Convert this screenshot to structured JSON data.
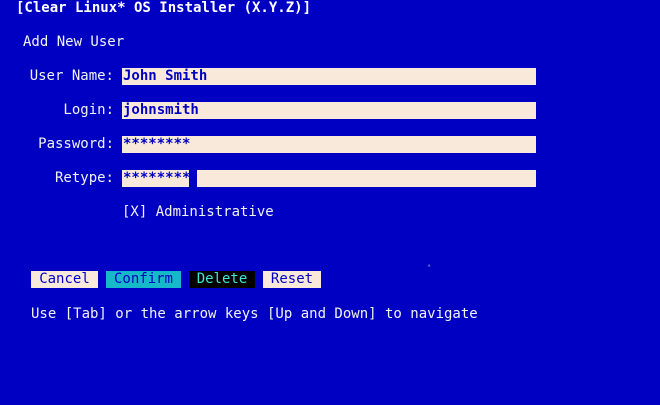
{
  "app": {
    "title": "[Clear Linux* OS Installer (X.Y.Z)]"
  },
  "page": {
    "title": "Add New User"
  },
  "form": {
    "user_name": {
      "label": "User Name:",
      "value": "John Smith"
    },
    "login": {
      "label": "Login:",
      "value": "johnsmith"
    },
    "password": {
      "label": "Password:",
      "value": "********"
    },
    "retype": {
      "label": "Retype:",
      "value": "********"
    },
    "administrative": {
      "label": "[X] Administrative",
      "checked": true
    }
  },
  "buttons": {
    "cancel": "Cancel",
    "confirm": "Confirm",
    "delete": "Delete",
    "reset": "Reset"
  },
  "help_text": "Use [Tab] or the arrow keys [Up and Down] to navigate",
  "colors": {
    "background": "#0000c3",
    "field": "#f9e9db",
    "confirm_focus": "#17b8c9",
    "delete_bg": "#000000",
    "delete_text": "#42e6d6"
  }
}
